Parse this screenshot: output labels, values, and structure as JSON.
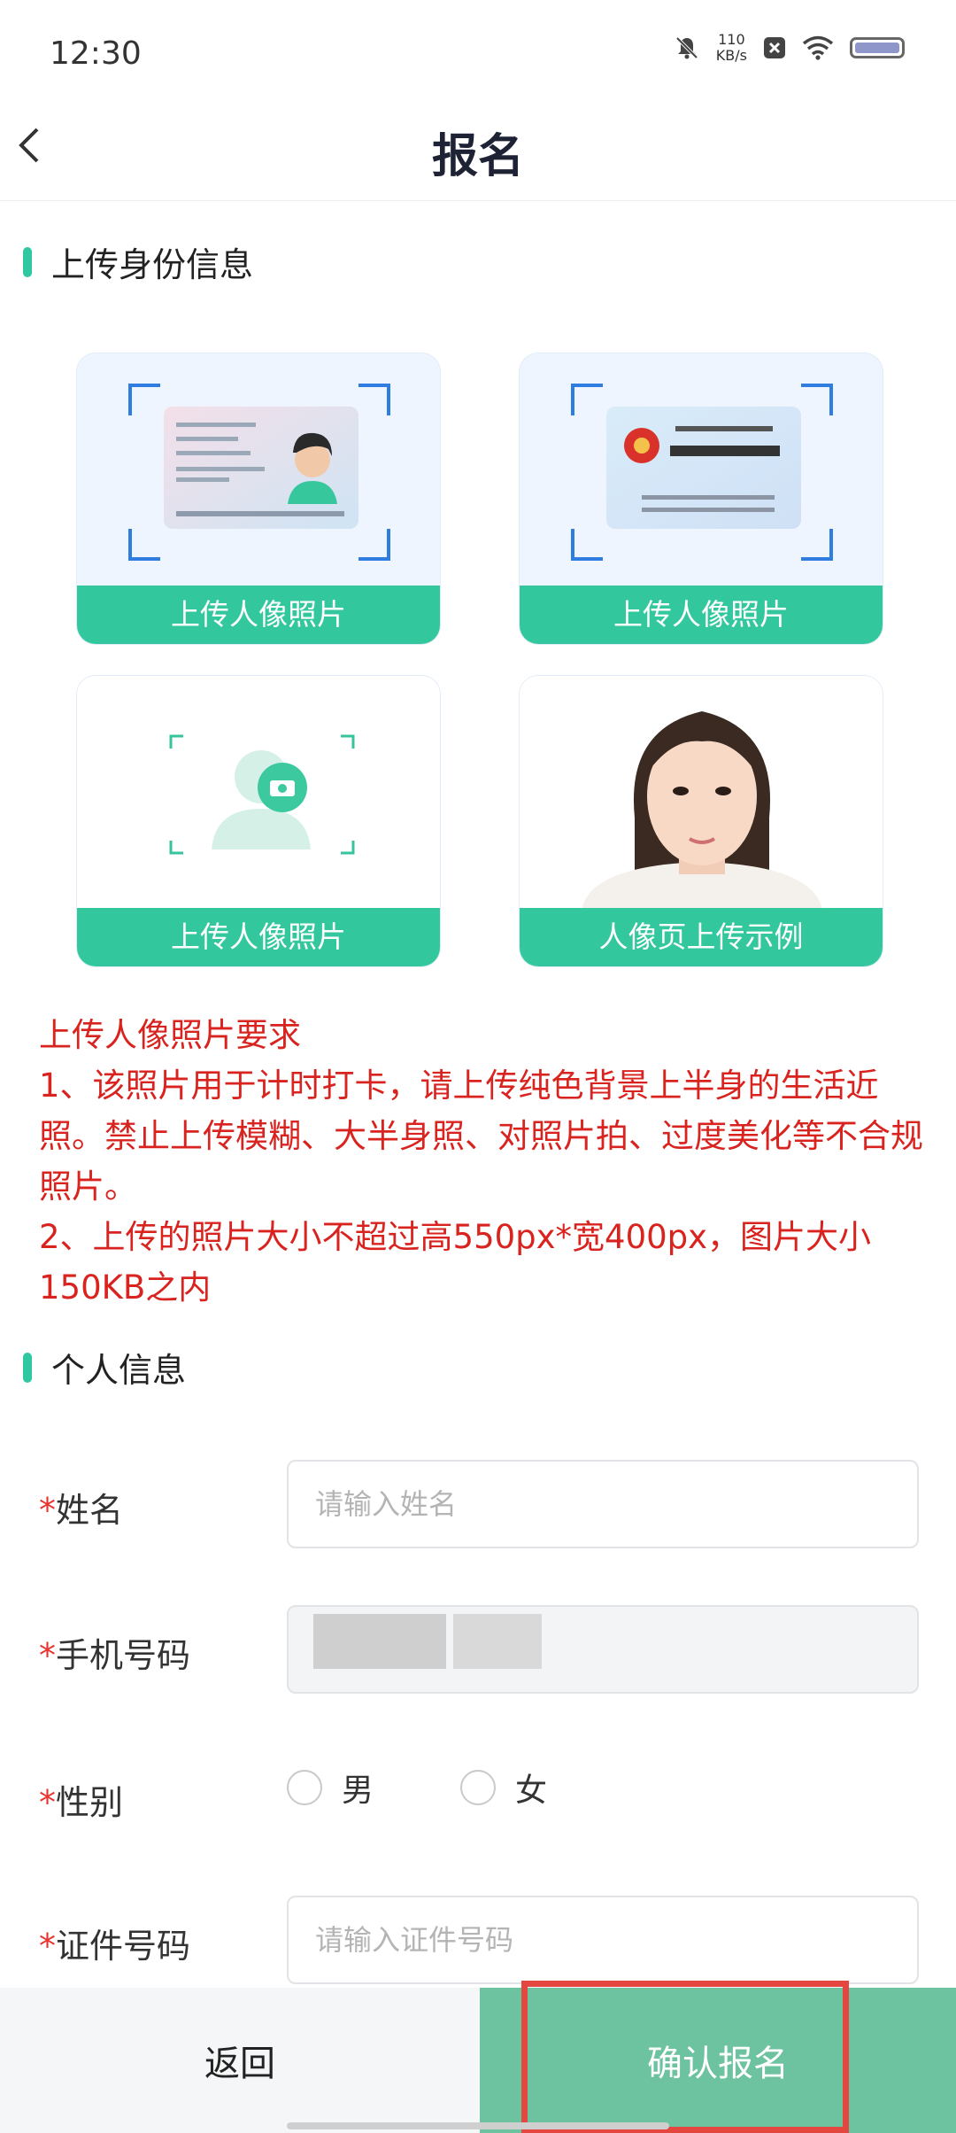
{
  "status_bar": {
    "time": "12:30",
    "speed_value": "110",
    "speed_unit": "KB/s",
    "icons": [
      "bell-mute-icon",
      "close-box-icon",
      "wifi-icon",
      "battery-icon"
    ]
  },
  "header": {
    "title": "报名"
  },
  "section_upload": {
    "title": "上传身份信息"
  },
  "upload_cards": [
    {
      "label": "上传人像照片"
    },
    {
      "label": "上传人像照片"
    },
    {
      "label": "上传人像照片"
    },
    {
      "label": "人像页上传示例"
    }
  ],
  "requirements": {
    "title": "上传人像照片要求",
    "item1": "1、该照片用于计时打卡，请上传纯色背景上半身的生活近照。禁止上传模糊、大半身照、对照片拍、过度美化等不合规照片。",
    "item2": "2、上传的照片大小不超过高550px*宽400px，图片大小150KB之内"
  },
  "section_personal": {
    "title": "个人信息"
  },
  "form": {
    "required_mark": "*",
    "name_label": "姓名",
    "name_placeholder": "请输入姓名",
    "phone_label": "手机号码",
    "gender_label": "性别",
    "gender_male": "男",
    "gender_female": "女",
    "id_label": "证件号码",
    "id_placeholder": "请输入证件号码"
  },
  "footer": {
    "back_label": "返回",
    "confirm_label": "确认报名"
  },
  "colors": {
    "accent": "#33c79d",
    "confirm_button": "#6dc2a0",
    "warning_text": "#d9231f",
    "highlight_box": "#e4473f"
  }
}
